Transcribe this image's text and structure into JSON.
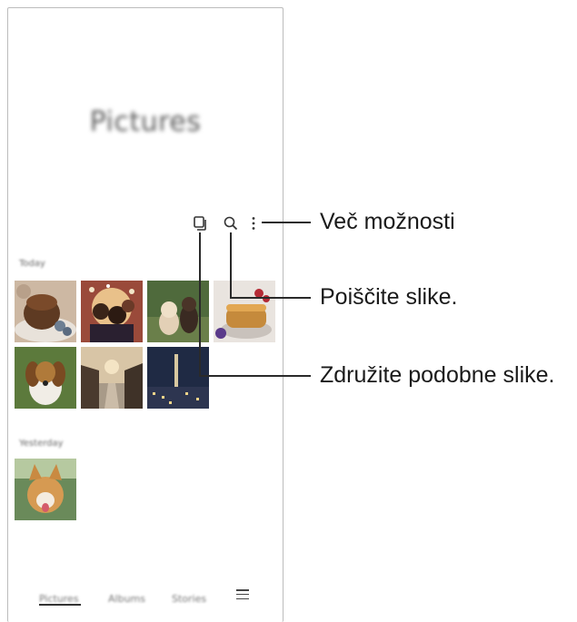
{
  "screen": {
    "title": "Pictures",
    "sections": [
      {
        "label": "Today"
      },
      {
        "label": "Yesterday"
      }
    ],
    "bottom_nav": [
      {
        "label": "Pictures"
      },
      {
        "label": "Albums"
      },
      {
        "label": "Stories"
      }
    ],
    "toolbar_icons": [
      "group-similar-icon",
      "search-icon",
      "more-options-icon"
    ],
    "menu_icon": "menu-icon"
  },
  "callouts": {
    "more_options": "Več možnosti",
    "search": "Poiščite slike.",
    "group_similar": "Združite podobne slike."
  }
}
